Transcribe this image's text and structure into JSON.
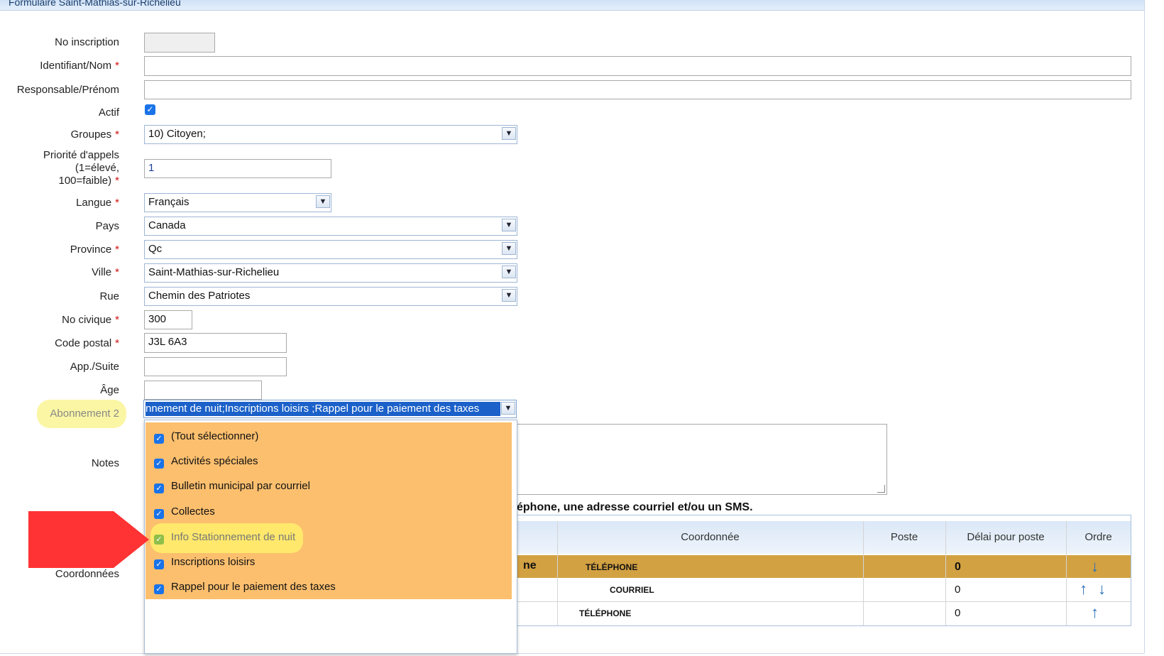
{
  "window": {
    "title": "Formulaire Saint-Mathias-sur-Richelieu"
  },
  "form": {
    "no_inscription": {
      "label": "No inscription",
      "value": ""
    },
    "identifiant": {
      "label": "Identifiant/Nom",
      "value": ""
    },
    "responsable": {
      "label": "Responsable/Prénom",
      "value": ""
    },
    "actif": {
      "label": "Actif",
      "checked": true
    },
    "groupes": {
      "label": "Groupes",
      "value": "10) Citoyen;"
    },
    "priorite": {
      "label_l1": "Priorité d'appels",
      "label_l2": "(1=élevé,",
      "label_l3": "100=faible)",
      "value": "1"
    },
    "langue": {
      "label": "Langue",
      "value": "Français"
    },
    "pays": {
      "label": "Pays",
      "value": "Canada"
    },
    "province": {
      "label": "Province",
      "value": "Qc"
    },
    "ville": {
      "label": "Ville",
      "value": "Saint-Mathias-sur-Richelieu"
    },
    "rue": {
      "label": "Rue",
      "value": "Chemin des Patriotes"
    },
    "no_civique": {
      "label": "No civique",
      "value": "300"
    },
    "code_postal": {
      "label": "Code postal",
      "value": "J3L 6A3"
    },
    "app_suite": {
      "label": "App./Suite",
      "value": ""
    },
    "age": {
      "label": "Âge",
      "value": ""
    },
    "abonnement": {
      "label": "Abonnement 2",
      "value": "nnement de nuit;Inscriptions loisirs ;Rappel pour le paiement des taxes"
    },
    "notes": {
      "label": "Notes",
      "value": ""
    },
    "coordonnees": {
      "label": "Coordonnées"
    },
    "required_mark": "*"
  },
  "dropdown": {
    "items": [
      {
        "label": "(Tout sélectionner)",
        "checked": true
      },
      {
        "label": "Activités spéciales",
        "checked": true
      },
      {
        "label": "Bulletin municipal par courriel",
        "checked": true
      },
      {
        "label": "Collectes",
        "checked": true
      },
      {
        "label": "Info Stationnement de nuit",
        "checked": true
      },
      {
        "label": "Inscriptions loisirs",
        "checked": true
      },
      {
        "label": "Rappel pour le paiement des taxes",
        "checked": true
      }
    ]
  },
  "coords_note": "éphone, une adresse courriel et/ou un SMS.",
  "table": {
    "headers": {
      "coordonnee": "Coordonnée",
      "poste": "Poste",
      "delai": "Délai pour poste",
      "ordre": "Ordre"
    },
    "rows": [
      {
        "type_frag": "ne",
        "coordonnee": "TÉLÉPHONE",
        "delai": "0"
      },
      {
        "coordonnee": "COURRIEL",
        "delai": "0"
      },
      {
        "coordonnee": "TÉLÉPHONE",
        "delai": "0"
      }
    ]
  },
  "icons": {
    "dropdown": "chevron-down-icon",
    "check": "check-icon",
    "arrow_up": "arrow-up-icon",
    "arrow_down": "arrow-down-icon"
  },
  "colors": {
    "accent": "#1a73e8",
    "dropdown_bg": "#fcbf6e",
    "selected_row": "#d2a142",
    "annotation_arrow": "#ff3333",
    "highlight": "#fff36b"
  }
}
